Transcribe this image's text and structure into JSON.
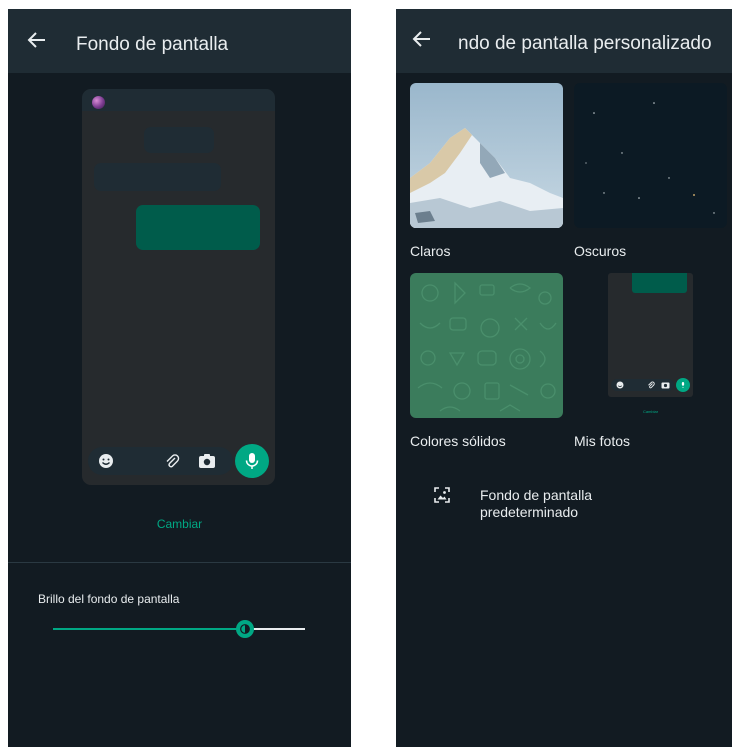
{
  "left": {
    "title": "Fondo de pantalla",
    "change_label": "Cambiar",
    "brightness": {
      "label": "Brillo del fondo de pantalla",
      "value": 0.76
    }
  },
  "right": {
    "title": "ndo de pantalla personalizado",
    "categories": [
      {
        "label": "Claros"
      },
      {
        "label": "Oscuros"
      },
      {
        "label": "Colores sólidos"
      },
      {
        "label": "Mis fotos"
      }
    ],
    "my_photos_preview_label": "Cambiar",
    "default_option_label": "Fondo de pantalla predeterminado"
  },
  "colors": {
    "background": "#121b22",
    "appbar": "#1f2c34",
    "accent": "#00a884",
    "outgoing_bubble": "#005c4b",
    "text": "#e9edef"
  },
  "icons": [
    "back-arrow-icon",
    "emoji-icon",
    "attach-icon",
    "camera-icon",
    "mic-icon",
    "wallpaper-icon"
  ]
}
